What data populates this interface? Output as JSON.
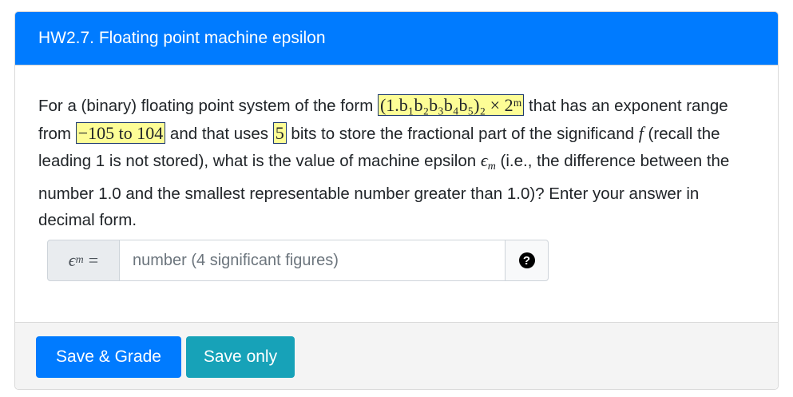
{
  "card": {
    "title": "HW2.7. Floating point machine epsilon"
  },
  "question": {
    "p1": "For a (binary) floating point system of the form ",
    "form_expr": "(1.b₁b₂b₃b₄b₅)₂ × 2ᵐ",
    "p2": " that has an exponent range from ",
    "exp_range": "−105 to 104",
    "p3": " and that uses ",
    "bits": "5",
    "p4": " bits to store the fractional part of the significand ",
    "f_sym": "f",
    "p5": " (recall the leading 1 is not stored), what is the value of machine epsilon ",
    "eps_sym": "ϵ",
    "eps_sub": "m",
    "p6": " (i.e., the difference between the number 1.0 and the smallest representable number greater than 1.0)? Enter your answer in decimal form."
  },
  "answer": {
    "label_sym": "ϵ",
    "label_sub": "m",
    "label_eq": " =",
    "value": "",
    "placeholder": "number (4 significant figures)",
    "help_glyph": "?"
  },
  "footer": {
    "grade_label": "Save & Grade",
    "save_label": "Save only"
  },
  "colors": {
    "header_bg": "#007bff",
    "grade_btn": "#007bff",
    "save_btn": "#17a2b8",
    "highlight": "#fdfd96"
  }
}
